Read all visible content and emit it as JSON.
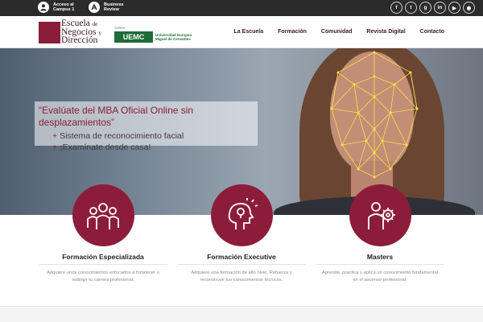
{
  "topbar": {
    "campus_label": "Acceso al Campus 1",
    "campus_line1": "Acceso al",
    "campus_line2": "Campus 1",
    "review_line1": "Business",
    "review_line2": "Review",
    "social_icons": [
      "facebook-icon",
      "twitter-icon",
      "google-plus-icon",
      "linkedin-icon",
      "youtube-icon",
      "rss-icon"
    ],
    "social_glyphs": [
      "f",
      "t",
      "g",
      "in",
      "▶",
      "◉"
    ]
  },
  "header": {
    "logo_line1": "Escuela",
    "logo_line1_small": "de",
    "logo_line2": "Negocios",
    "logo_line2_small": "y",
    "logo_line3": "Dirección",
    "gestor": "Gestor",
    "uemc": "UEMC",
    "uemc_sub1": "Universidad Europea",
    "uemc_sub2": "Miguel de Cervantes",
    "nav": [
      "La Escuela",
      "Formación",
      "Comunidad",
      "Revista Digital",
      "Contacto"
    ]
  },
  "hero": {
    "title": "“Evalúate del MBA Oficial Online sin desplazamientos”",
    "line1": "Sistema de reconocimiento facial",
    "line2": "¡Examínate desde casa!",
    "plus": "+"
  },
  "features": [
    {
      "icon": "group-people-icon",
      "title": "Formación Especializada",
      "desc": "Adquiere unos conocimientos enfocados a fortalecer o redirigir tu carrera profesional."
    },
    {
      "icon": "head-lightbulb-icon",
      "title": "Formación Executive",
      "desc": "Adquiere una formación de alto nivel. Refuerza y reconstruye tus conocimientos técnicos."
    },
    {
      "icon": "person-gear-icon",
      "title": "Masters",
      "desc": "Aprende, practica y aplica un conocimiento fundamental en el ascenso profesional."
    }
  ],
  "colors": {
    "brand": "#8c1d3a",
    "topbar": "#2b2b2b",
    "uemc_green": "#1f6b3a"
  }
}
